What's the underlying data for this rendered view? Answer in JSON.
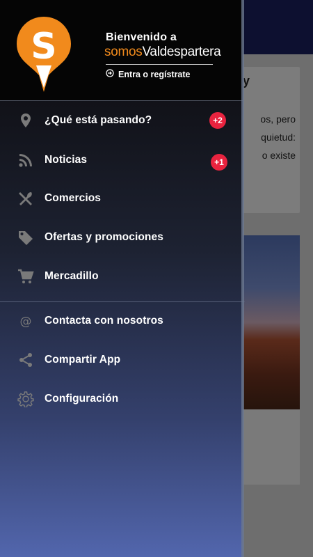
{
  "background": {
    "card_title": "y",
    "card_text_lines": [
      "os, pero",
      "quietud:",
      "o existe"
    ]
  },
  "header": {
    "welcome": "Bienvenido a",
    "brand_part1": "somos",
    "brand_part2": "Valdespartera",
    "login_label": "Entra o regístrate",
    "logo_letter": "S"
  },
  "menu": {
    "primary": [
      {
        "label": "¿Qué está pasando?",
        "icon": "location-pin-icon",
        "badge": "+2"
      },
      {
        "label": "Noticias",
        "icon": "rss-icon",
        "badge": "+1"
      },
      {
        "label": "Comercios",
        "icon": "restaurant-icon"
      },
      {
        "label": "Ofertas y promociones",
        "icon": "tag-icon"
      },
      {
        "label": "Mercadillo",
        "icon": "cart-icon"
      }
    ],
    "secondary": [
      {
        "label": "Contacta con nosotros",
        "icon": "at-icon"
      },
      {
        "label": "Compartir App",
        "icon": "share-icon"
      },
      {
        "label": "Configuración",
        "icon": "gear-icon"
      }
    ]
  },
  "colors": {
    "brand_orange": "#f18a1c",
    "badge_red": "#e8233f"
  }
}
